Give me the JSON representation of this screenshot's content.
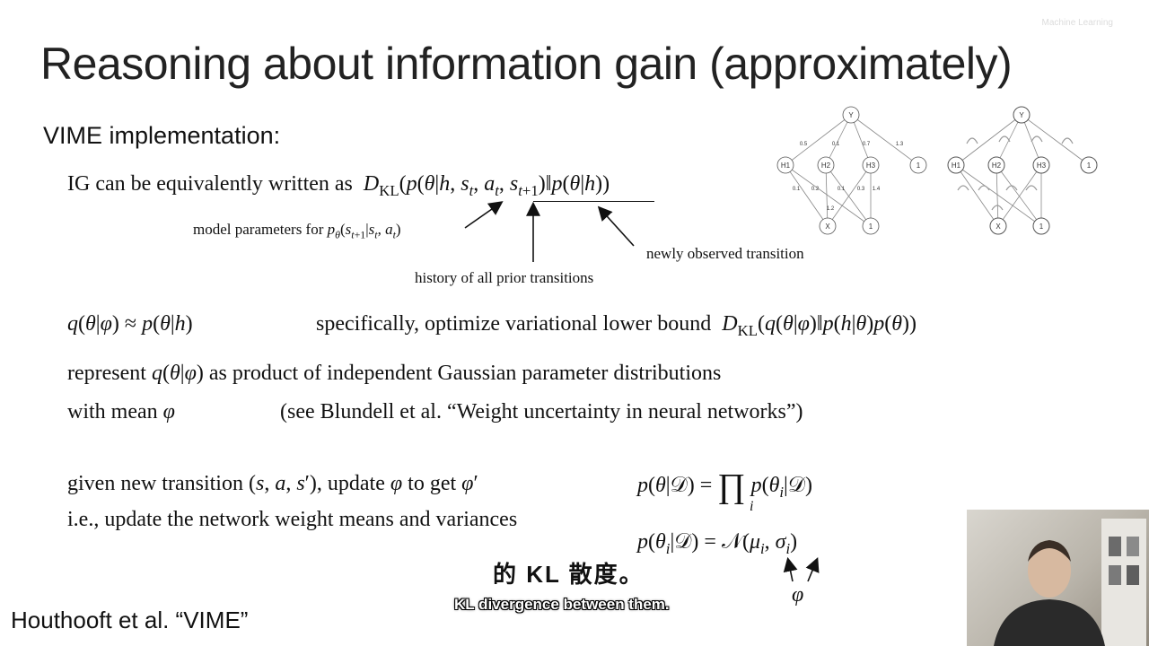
{
  "slide": {
    "watermark": "Machine Learning",
    "title": "Reasoning about information gain (approximately)",
    "section_heading": "VIME implementation:",
    "ig_prefix": "IG can be equivalently written as",
    "ann_model_params": "model parameters for",
    "ann_history": "history of all prior transitions",
    "ann_new_transition": "newly observed transition",
    "specifically_text": "specifically, optimize variational lower bound",
    "represent_prefix": "represent",
    "represent_suffix": "as product of independent Gaussian parameter distributions",
    "mean_text": "with mean",
    "see_text": "(see Blundell et al. “Weight uncertainty in neural networks”)",
    "given_prefix": "given new transition",
    "given_mid": ", update",
    "given_suffix": "to get",
    "update_text": "i.e., update the network weight means and variances",
    "citation": "Houthooft et al. “VIME”"
  },
  "diagram": {
    "left_nodes": [
      "Y",
      "H1",
      "H2",
      "H3",
      "1",
      "X",
      "1"
    ],
    "right_nodes": [
      "Y",
      "H1",
      "H2",
      "H3",
      "1",
      "X",
      "1"
    ],
    "left_weights_top": [
      "0.5",
      "0.1",
      "0.7",
      "1.3"
    ],
    "left_weights_bottom": [
      "0.1",
      "0.2",
      "0.1",
      "0.3",
      "1.4",
      "1.2"
    ]
  },
  "subtitles": {
    "chinese": "的 KL 散度。",
    "english": "KL divergence between them."
  }
}
